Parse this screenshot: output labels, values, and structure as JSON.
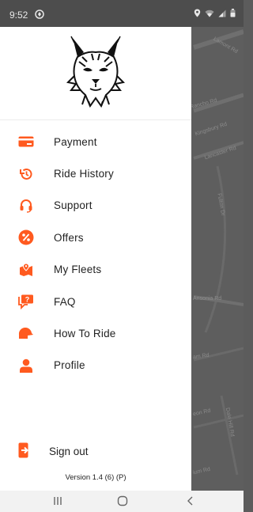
{
  "status_bar": {
    "time": "9:52"
  },
  "map": {
    "streets": [
      "Lamont Rd",
      "Rancho Rd",
      "Kingsbury Rd",
      "Lancaster Rd",
      "Fulton Dr",
      "Ansonia Rd",
      "am Rd",
      "Dale Hill Rd",
      "eon Rd",
      "ium Rd"
    ]
  },
  "drawer": {
    "logo_icon": "lynx-logo",
    "menu": [
      {
        "label": "Payment",
        "icon": "credit-card-icon"
      },
      {
        "label": "Ride History",
        "icon": "history-icon"
      },
      {
        "label": "Support",
        "icon": "headset-icon"
      },
      {
        "label": "Offers",
        "icon": "percent-badge-icon"
      },
      {
        "label": "My Fleets",
        "icon": "map-pin-icon"
      },
      {
        "label": "FAQ",
        "icon": "question-chat-icon"
      },
      {
        "label": "How To Ride",
        "icon": "helmet-icon"
      },
      {
        "label": "Profile",
        "icon": "person-icon"
      }
    ],
    "sign_out": {
      "label": "Sign out",
      "icon": "sign-out-icon"
    },
    "version": "Version 1.4 (6) (P)"
  },
  "colors": {
    "accent": "#ff5a1f",
    "drawer_bg": "#ffffff",
    "map_bg": "#5e5e5e"
  }
}
